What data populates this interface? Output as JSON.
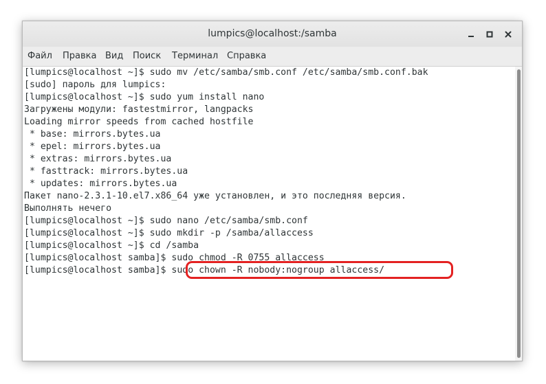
{
  "window": {
    "title": "lumpics@localhost:/samba"
  },
  "icons": {
    "minimize": "minimize-icon",
    "maximize": "maximize-icon",
    "close": "close-icon"
  },
  "menu": {
    "items": [
      {
        "label": "Файл"
      },
      {
        "label": "Правка"
      },
      {
        "label": "Вид"
      },
      {
        "label": "Поиск"
      },
      {
        "label": "Терминал"
      },
      {
        "label": "Справка"
      }
    ]
  },
  "terminal": {
    "lines": [
      "[lumpics@localhost ~]$ sudo mv /etc/samba/smb.conf /etc/samba/smb.conf.bak",
      "[sudo] пароль для lumpics:",
      "[lumpics@localhost ~]$ sudo yum install nano",
      "Загружены модули: fastestmirror, langpacks",
      "Loading mirror speeds from cached hostfile",
      " * base: mirrors.bytes.ua",
      " * epel: mirrors.bytes.ua",
      " * extras: mirrors.bytes.ua",
      " * fasttrack: mirrors.bytes.ua",
      " * updates: mirrors.bytes.ua",
      "Пакет nano-2.3.1-10.el7.x86_64 уже установлен, и это последняя версия.",
      "Выполнять нечего",
      "[lumpics@localhost ~]$ sudo nano /etc/samba/smb.conf",
      "[lumpics@localhost ~]$ sudo mkdir -p /samba/allaccess",
      "[lumpics@localhost ~]$ cd /samba",
      "[lumpics@localhost samba]$ sudo chmod -R 0755 allaccess"
    ],
    "current_prompt": "[lumpics@localhost samba]$",
    "current_command": " sudo chown -R nobody:nogroup allaccess/"
  },
  "colors": {
    "highlight": "#e32121",
    "text": "#2e3436"
  }
}
